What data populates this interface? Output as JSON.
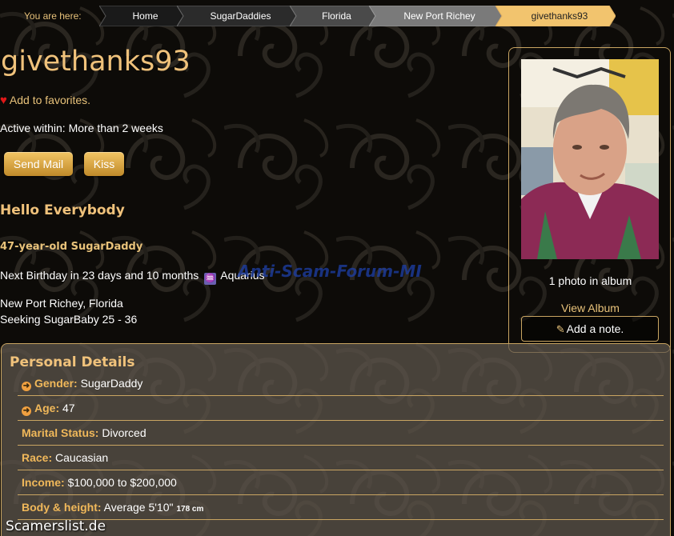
{
  "breadcrumb": {
    "here_label": "You are here:",
    "items": [
      "Home",
      "SugarDaddies",
      "Florida",
      "New Port Richey",
      "givethanks93"
    ]
  },
  "profile": {
    "username": "givethanks93",
    "favorites_label": "Add to favorites.",
    "active": "Active within: More than 2 weeks",
    "send_mail": "Send Mail",
    "kiss": "Kiss",
    "headline": "Hello Everybody",
    "age_tag": "47-year-old SugarDaddy",
    "birthday": "Next Birthday in 23 days and 10 months",
    "zodiac": "Aquarius",
    "location": "New Port Richey, Florida",
    "seeking": "Seeking SugarBaby 25 - 36"
  },
  "photo_panel": {
    "photo_count": "1 photo in album",
    "view_album": "View Album",
    "add_note": "Add a note."
  },
  "watermark": "Anti-Scam-Forum-MI",
  "details": {
    "title": "Personal Details",
    "rows": [
      {
        "label": "Gender:",
        "value": "SugarDaddy",
        "icon": "arrow-circle-right-icon"
      },
      {
        "label": "Age:",
        "value": "47",
        "icon": "arrow-circle-right-icon"
      },
      {
        "label": "Marital Status:",
        "value": "Divorced"
      },
      {
        "label": "Race:",
        "value": "Caucasian"
      },
      {
        "label": "Income:",
        "value": "$100,000 to $200,000"
      },
      {
        "label": "Body & height:",
        "value": "Average 5'10\"",
        "extra": "178 cm"
      }
    ]
  },
  "site_mark": "Scamerslist.de",
  "colors": {
    "gold": "#f0c27b",
    "heart": "#e01818",
    "button": "#d9a444",
    "panel": "#5f584e"
  }
}
